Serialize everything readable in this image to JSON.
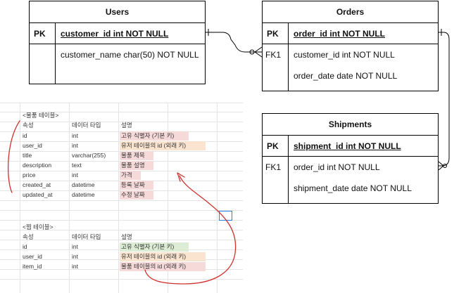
{
  "er": {
    "users": {
      "title": "Users",
      "pk_label": "PK",
      "pk_field": "customer_id int NOT NULL",
      "fields": [
        "customer_name char(50) NOT NULL"
      ]
    },
    "orders": {
      "title": "Orders",
      "pk_label": "PK",
      "pk_field": "order_id int NOT NULL",
      "fk_label": "FK1",
      "fields": [
        "customer_id int NOT NULL",
        "order_date date NOT NULL"
      ]
    },
    "shipments": {
      "title": "Shipments",
      "pk_label": "PK",
      "pk_field": "shipment_id int NOT NULL",
      "fk_label": "FK1",
      "fields": [
        "order_id int NOT NULL",
        "shipment_date date NOT NULL"
      ]
    }
  },
  "sheet": {
    "table1": {
      "title": "<물품 테이블>",
      "headers": [
        "속성",
        "데이터 타입",
        "설명"
      ],
      "rows": [
        [
          "id",
          "int",
          "고유 식별자 (기본 키)"
        ],
        [
          "user_id",
          "int",
          "유저 테이블의 id (외래 키)"
        ],
        [
          "title",
          "varchar(255)",
          "물품 제목"
        ],
        [
          "description",
          "text",
          "물품 설명"
        ],
        [
          "price",
          "int",
          "가격"
        ],
        [
          "created_at",
          "datetime",
          "등록 날짜"
        ],
        [
          "updated_at",
          "datetime",
          "수정 날짜"
        ]
      ]
    },
    "table2": {
      "title": "<찜 테이블>",
      "headers": [
        "속성",
        "데이터 타입",
        "설명"
      ],
      "rows": [
        [
          "id",
          "int",
          "고유 식별자 (기본 키)"
        ],
        [
          "user_id",
          "int",
          "유저 테이블의 id (외래 키)"
        ],
        [
          "item_id",
          "int",
          "물품 테이블의 id (외래 키)"
        ]
      ]
    }
  },
  "colors": {
    "pk_highlight": "#f6d9d9",
    "fk_highlight": "#fbe4cf",
    "pk_highlight_2": "#dcecd5",
    "annotation_red": "#d0312d",
    "selection_blue": "#2a7de1"
  }
}
